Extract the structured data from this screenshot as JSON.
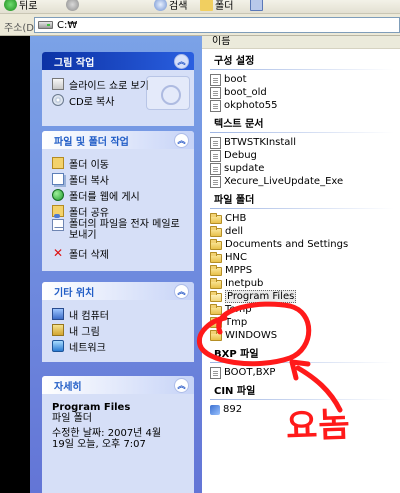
{
  "toolbar": {
    "back_label": "뒤로",
    "search_label": "검색",
    "folders_label": "폴더"
  },
  "address": {
    "label": "주소(D)",
    "value": "C:₩"
  },
  "column_header": "이름",
  "task_pane": {
    "picture_tasks": {
      "title": "그림 작업",
      "items": [
        "슬라이드 쇼로 보기",
        "CD로 복사"
      ]
    },
    "file_folder_tasks": {
      "title": "파일 및 폴더 작업",
      "items": [
        "폴더 이동",
        "폴더 복사",
        "폴더를 웹에 게시",
        "폴더 공유",
        "폴더의 파일을 전자 메일로 보내기",
        "폴더 삭제"
      ]
    },
    "other_places": {
      "title": "기타 위치",
      "items": [
        "내 컴퓨터",
        "내 그림",
        "네트워크"
      ]
    },
    "details": {
      "title": "자세히",
      "name": "Program Files",
      "type": "파일 폴더",
      "modified": "수정한 날짜: 2007년 4월 19일 오늘, 오후 7:07"
    }
  },
  "groups": {
    "config": {
      "title": "구성 설정",
      "items": [
        "boot",
        "boot_old",
        "okphoto55"
      ]
    },
    "text_docs": {
      "title": "텍스트 문서",
      "items": [
        "BTWSTKInstall",
        "Debug",
        "supdate",
        "Xecure_LiveUpdate_Exe"
      ]
    },
    "file_folders": {
      "title": "파일 폴더",
      "items": [
        "CHB",
        "dell",
        "Documents and Settings",
        "HNC",
        "MPPS",
        "Inetpub",
        "Program Files",
        "Temp",
        "Tmp",
        "WINDOWS"
      ]
    },
    "bxp": {
      "title": "BXP 파일",
      "items": [
        "BOOT,BXP"
      ]
    },
    "cin": {
      "title": "CIN 파일",
      "items": [
        "892"
      ]
    }
  },
  "annotation": {
    "text": "요놈",
    "color": "#ff1a1a"
  },
  "colors": {
    "taskpane_top": "#7ba2e7",
    "taskpane_bottom": "#6375d6",
    "header_text": "#215dc6",
    "selection": "#ebebeb"
  }
}
